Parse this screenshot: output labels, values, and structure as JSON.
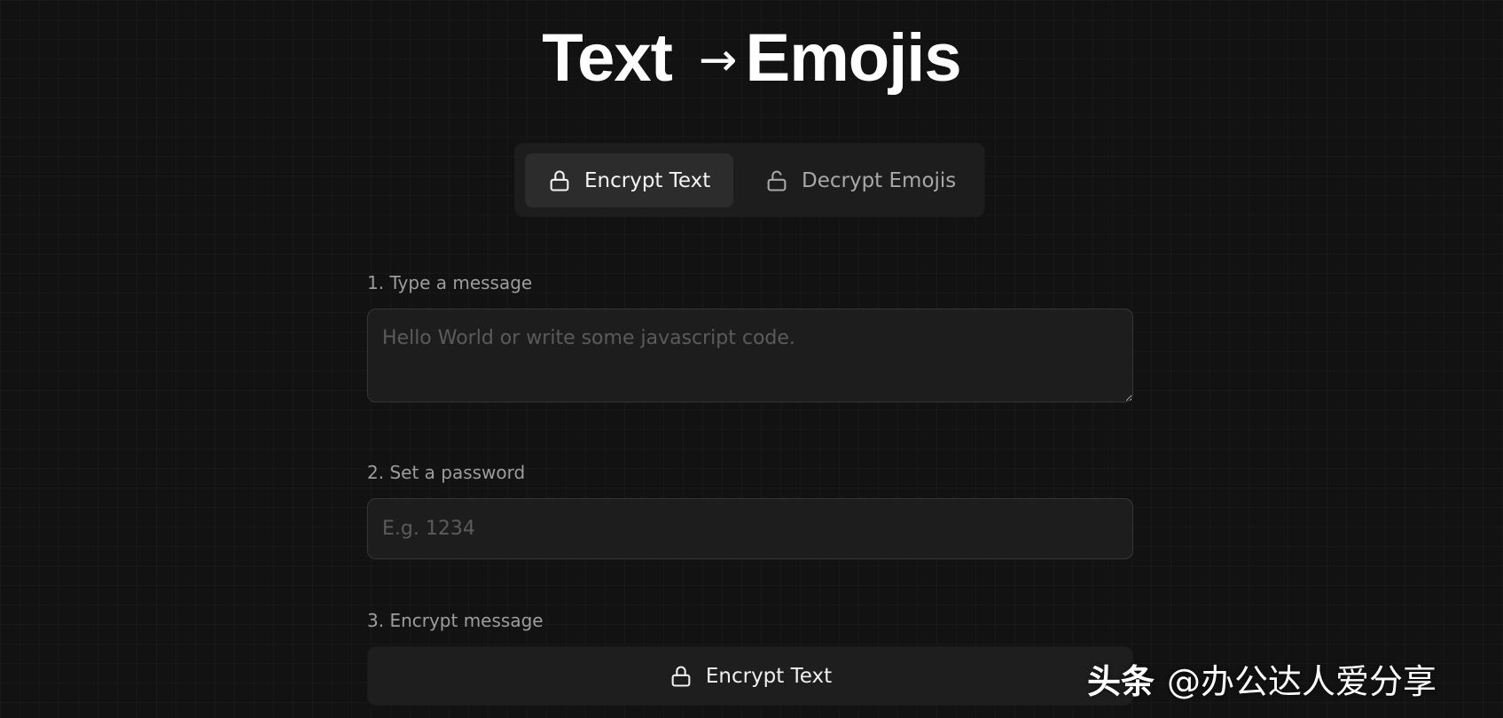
{
  "header": {
    "title_left": "Text",
    "title_arrow": "→",
    "title_right": "Emojis"
  },
  "tabs": [
    {
      "label": "Encrypt Text",
      "icon": "lock-icon",
      "active": true
    },
    {
      "label": "Decrypt Emojis",
      "icon": "unlock-icon",
      "active": false
    }
  ],
  "form": {
    "message": {
      "label": "1. Type a message",
      "placeholder": "Hello World or write some javascript code.",
      "value": ""
    },
    "password": {
      "label": "2. Set a password",
      "placeholder": "E.g. 1234",
      "value": ""
    },
    "encrypt": {
      "label": "3. Encrypt message",
      "button_label": "Encrypt Text",
      "button_icon": "lock-icon"
    }
  },
  "watermark": {
    "brand": "头条",
    "handle": "@办公达人爱分享"
  },
  "colors": {
    "background": "#121212",
    "panel": "#1d1d1d",
    "active_tab": "#2c2c2c",
    "text": "#f4f4f4",
    "muted": "#9d9d9d"
  }
}
